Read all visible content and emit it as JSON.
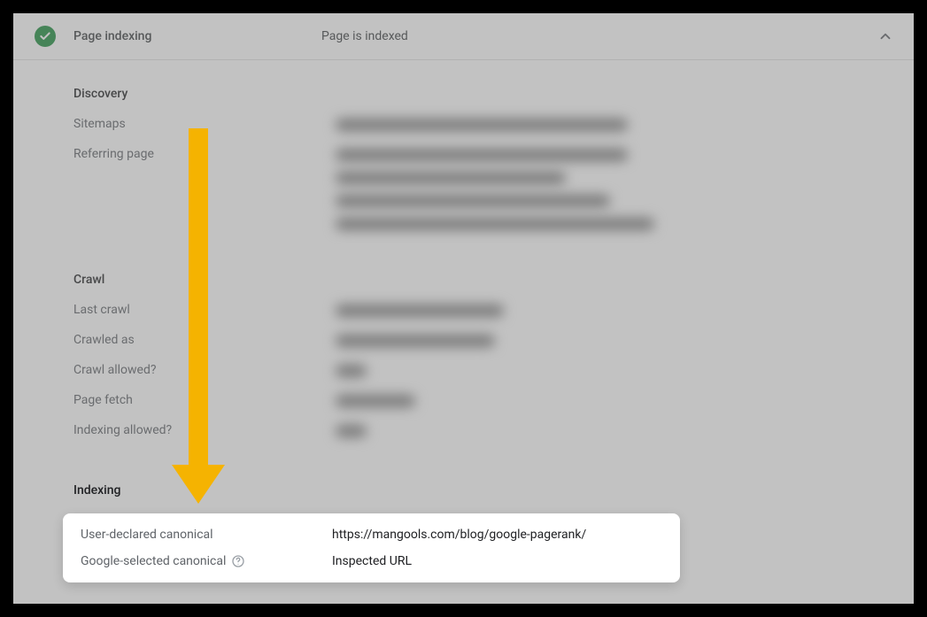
{
  "header": {
    "title": "Page indexing",
    "status": "Page is indexed"
  },
  "sections": {
    "discovery": {
      "title": "Discovery",
      "sitemaps_label": "Sitemaps",
      "referring_label": "Referring page"
    },
    "crawl": {
      "title": "Crawl",
      "last_crawl_label": "Last crawl",
      "crawled_as_label": "Crawled as",
      "crawl_allowed_label": "Crawl allowed?",
      "page_fetch_label": "Page fetch",
      "indexing_allowed_label": "Indexing allowed?"
    },
    "indexing": {
      "title": "Indexing",
      "user_canonical_label": "User-declared canonical",
      "user_canonical_value": "https://mangools.com/blog/google-pagerank/",
      "google_canonical_label": "Google-selected canonical",
      "google_canonical_value": "Inspected URL"
    }
  }
}
